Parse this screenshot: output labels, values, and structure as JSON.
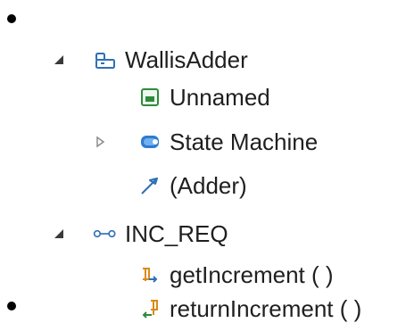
{
  "tree": {
    "items": [
      {
        "label": "WallisAdder",
        "expander": "expanded",
        "icon": "package-icon",
        "children": [
          {
            "label": "Unnamed",
            "icon": "document-icon"
          },
          {
            "label": "State Machine",
            "icon": "state-machine-icon",
            "expander": "collapsed"
          },
          {
            "label": "(Adder)",
            "icon": "generalization-arrow-icon"
          }
        ]
      },
      {
        "label": "INC_REQ",
        "expander": "expanded",
        "icon": "interface-icon",
        "children": [
          {
            "label": "getIncrement ( )",
            "icon": "operation-in-icon"
          },
          {
            "label": "returnIncrement ( )",
            "icon": "operation-out-icon"
          }
        ]
      }
    ]
  },
  "colors": {
    "accent_blue": "#2f6fb5",
    "text": "#1f1f1f",
    "green": "#2e8b3a",
    "orange": "#d98a16"
  }
}
